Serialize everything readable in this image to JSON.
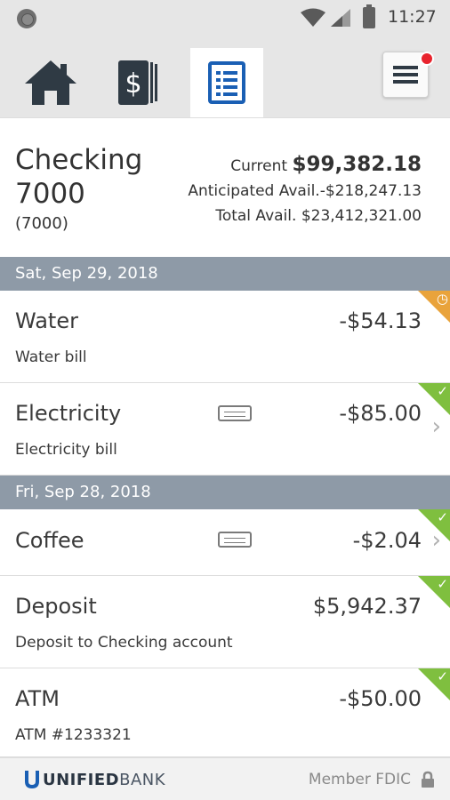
{
  "status_bar": {
    "time": "11:27"
  },
  "tabs": [
    {
      "name": "home",
      "icon": "home-icon"
    },
    {
      "name": "accounts",
      "icon": "dollar-cards-icon"
    },
    {
      "name": "activity",
      "icon": "document-list-icon",
      "active": true
    }
  ],
  "account": {
    "name": "Checking 7000",
    "number": "(7000)",
    "current_label": "Current",
    "current_value": "$99,382.18",
    "anticipated_label": "Anticipated Avail.",
    "anticipated_value": "-$218,247.13",
    "total_label": "Total Avail.",
    "total_value": "$23,412,321.00"
  },
  "groups": [
    {
      "date": "Sat, Sep 29, 2018",
      "transactions": [
        {
          "title": "Water",
          "description": "Water bill",
          "amount": "-$54.13",
          "status": "pending"
        },
        {
          "title": "Electricity",
          "description": "Electricity bill",
          "amount": "-$85.00",
          "status": "cleared",
          "card": true
        }
      ]
    },
    {
      "date": "Fri, Sep 28, 2018",
      "transactions": [
        {
          "title": "Coffee",
          "description": "",
          "amount": "-$2.04",
          "status": "cleared",
          "card": true
        },
        {
          "title": "Deposit",
          "description": "Deposit to Checking account",
          "amount": "$5,942.37",
          "status": "cleared"
        },
        {
          "title": "ATM",
          "description": "ATM #1233321",
          "amount": "-$50.00",
          "status": "cleared"
        }
      ]
    }
  ],
  "footer": {
    "logo_bold": "UNIFIED",
    "logo_thin": "BANK",
    "fdic": "Member FDIC"
  },
  "colors": {
    "accent_blue": "#1a5fb4",
    "date_bar": "#8e9aa7",
    "cleared": "#7fbf3f",
    "pending": "#e9a33b",
    "notification": "#e8232d"
  }
}
